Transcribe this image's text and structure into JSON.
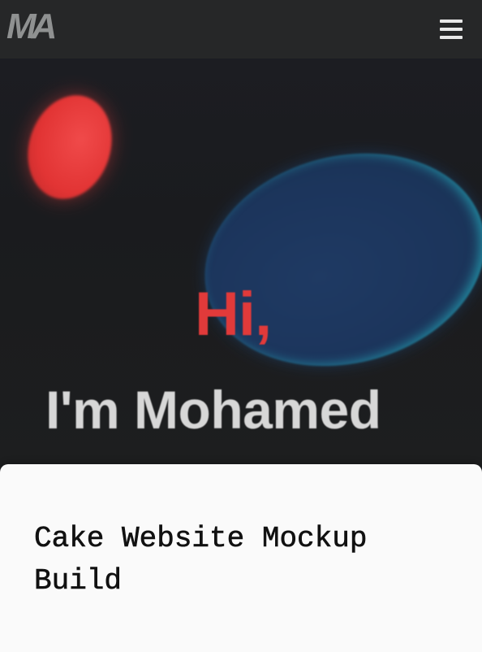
{
  "header": {
    "logo_text": "MA",
    "menu_icon": "hamburger-menu-icon"
  },
  "hero": {
    "greeting": "Hi,",
    "name_line": "I'm Mohamed",
    "colors": {
      "accent_red": "#e13a3a",
      "accent_blue": "#1c355c",
      "glow_cyan": "#28d2dc"
    }
  },
  "card": {
    "title": "Cake Website Mockup Build"
  }
}
